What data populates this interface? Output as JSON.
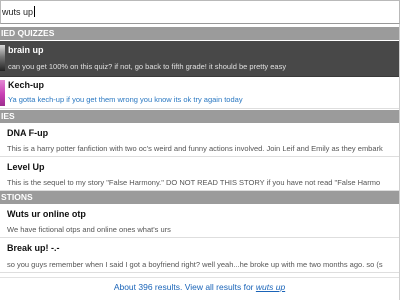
{
  "search": {
    "query": "wuts up"
  },
  "sections": {
    "quizzes": {
      "header": "IED QUIZZES",
      "items": [
        {
          "title": "brain up",
          "description": "can you get 100% on this quiz? if not, go back to fifth grade! it should be pretty easy"
        },
        {
          "title": "Kech-up",
          "description": "Ya gotta kech-up if you get them wrong you know its ok try again today"
        }
      ]
    },
    "stories": {
      "header": "IES",
      "items": [
        {
          "title": "DNA F-up",
          "description": "This is a harry potter fanfiction with two oc's weird and funny actions involved. Join Leif and Emily as they embark"
        },
        {
          "title": "Level Up",
          "description": "This is the sequel to my story \"False Harmony.\" DO NOT READ THIS STORY if you have not read \"False Harmo"
        }
      ]
    },
    "questions": {
      "header": "STIONS",
      "items": [
        {
          "title": "Wuts ur online otp",
          "description": "We have fictional otps and online ones what's urs"
        },
        {
          "title": "Break up! -.-",
          "description": "so you guys remember when I said I got a boyfriend right? well yeah...he broke up with me two months ago. so (s"
        }
      ]
    }
  },
  "footer": {
    "prefix": "About 396 results. View all results for",
    "term": "wuts up"
  }
}
